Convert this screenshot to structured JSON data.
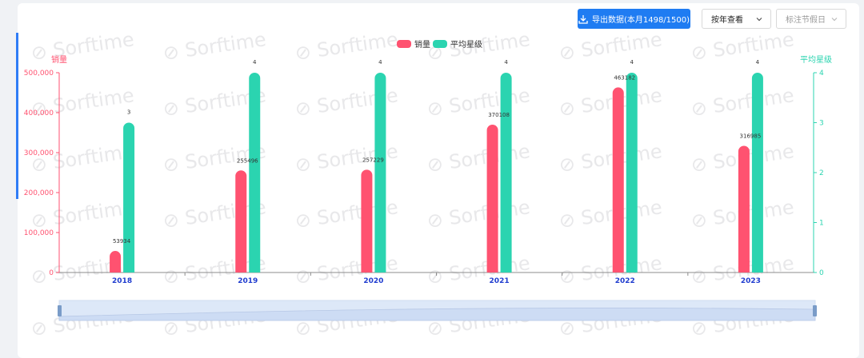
{
  "toolbar": {
    "export_label": "导出数据(本月1498/1500)",
    "view_select_value": "按年查看",
    "holiday_select_placeholder": "标注节假日"
  },
  "watermark_text": "Sorftime",
  "colors": {
    "sales": "#ff5270",
    "rating": "#2bd4b0",
    "category_text": "#1f3ccf",
    "accent": "#2f7cf6"
  },
  "chart_data": {
    "type": "bar",
    "categories": [
      "2018",
      "2019",
      "2020",
      "2021",
      "2022",
      "2023"
    ],
    "series": [
      {
        "name": "销量",
        "values": [
          53934,
          255496,
          257229,
          370108,
          463182,
          316985
        ],
        "labels": [
          "53934",
          "255496",
          "257229",
          "370108",
          "463182",
          "316985"
        ],
        "axis": "left"
      },
      {
        "name": "平均星级",
        "values": [
          3,
          4,
          4,
          4,
          4,
          4
        ],
        "labels": [
          "3",
          "4",
          "4",
          "4",
          "4",
          "4"
        ],
        "axis": "right"
      }
    ],
    "y_left": {
      "name": "销量",
      "min": 0,
      "max": 500000,
      "ticks": [
        "0",
        "100,000",
        "200,000",
        "300,000",
        "400,000",
        "500,000"
      ]
    },
    "y_right": {
      "name": "平均星级",
      "min": 0,
      "max": 4,
      "ticks": [
        "0",
        "1",
        "2",
        "3",
        "4"
      ]
    },
    "legend_position": "top-center",
    "grid": false,
    "has_zoom_slider": true
  }
}
